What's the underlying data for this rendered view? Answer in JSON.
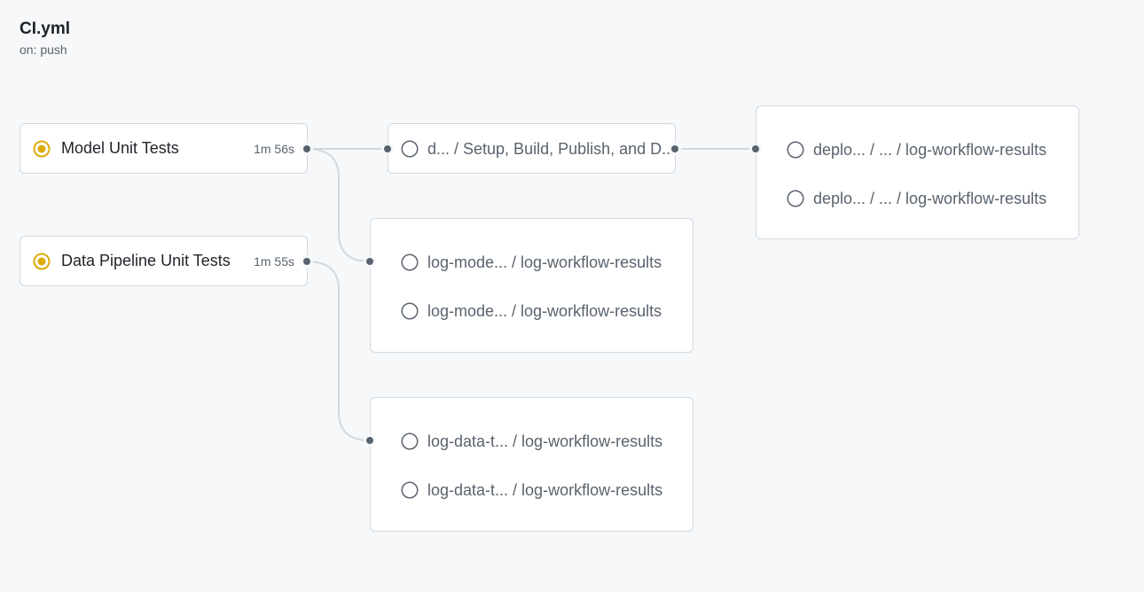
{
  "workflow": {
    "name": "CI.yml",
    "trigger": "on: push"
  },
  "jobs": [
    {
      "label": "Model Unit Tests",
      "duration": "1m 56s",
      "status": "in-progress",
      "status_color": "#dbab0a"
    },
    {
      "label": "Data Pipeline Unit Tests",
      "duration": "1m 55s",
      "status": "in-progress",
      "status_color": "#dbab0a"
    }
  ],
  "deploy_job": {
    "label": "d... / Setup, Build, Publish, and D...",
    "status": "pending"
  },
  "deploy_log_group": {
    "items": [
      {
        "label": "deplo... / ... / log-workflow-results",
        "status": "pending"
      },
      {
        "label": "deplo... / ... / log-workflow-results",
        "status": "pending"
      }
    ]
  },
  "model_log_group": {
    "items": [
      {
        "label": "log-mode... / log-workflow-results",
        "status": "pending"
      },
      {
        "label": "log-mode... / log-workflow-results",
        "status": "pending"
      }
    ]
  },
  "data_log_group": {
    "items": [
      {
        "label": "log-data-t... / log-workflow-results",
        "status": "pending"
      },
      {
        "label": "log-data-t... / log-workflow-results",
        "status": "pending"
      }
    ]
  },
  "colors": {
    "background": "#f6f8fa",
    "border": "#d1d9e0",
    "connector": "#d1d9e0",
    "node": "#59636e",
    "running": "#dbab0a",
    "pending_text": "#59636e"
  }
}
